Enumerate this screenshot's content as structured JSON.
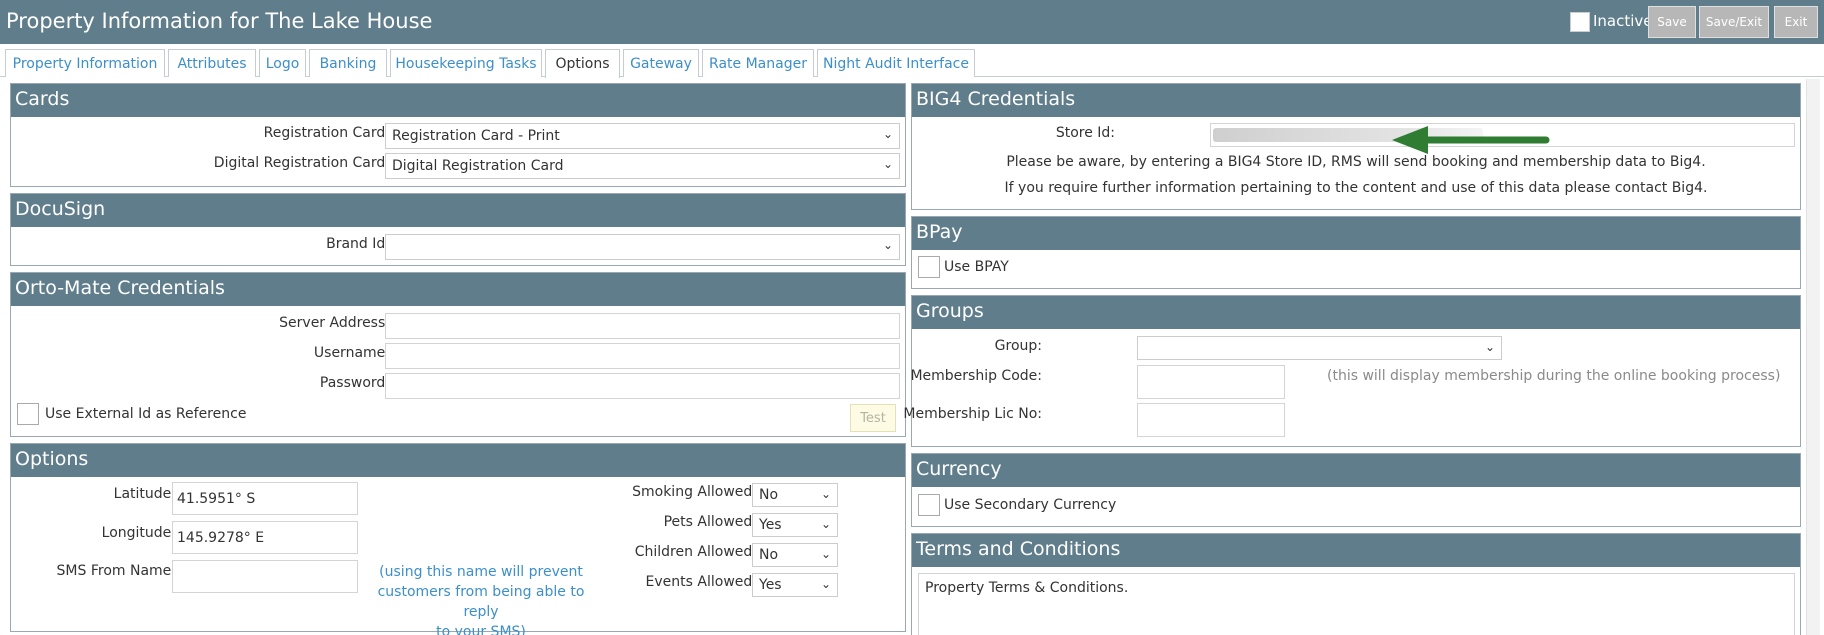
{
  "window": {
    "title": "Property Information for The Lake House",
    "inactive_label": "Inactive",
    "buttons": {
      "save": "Save",
      "save_exit": "Save/Exit",
      "exit": "Exit"
    }
  },
  "tabs": [
    {
      "label": "Property Information"
    },
    {
      "label": "Attributes"
    },
    {
      "label": "Logo"
    },
    {
      "label": "Banking"
    },
    {
      "label": "Housekeeping Tasks"
    },
    {
      "label": "Options"
    },
    {
      "label": "Gateway"
    },
    {
      "label": "Rate Manager"
    },
    {
      "label": "Night Audit Interface"
    }
  ],
  "cards": {
    "title": "Cards",
    "registration_card_label": "Registration Card:",
    "registration_card_value": "Registration Card - Print",
    "digital_registration_card_label": "Digital Registration Card:",
    "digital_registration_card_value": "Digital Registration Card"
  },
  "docusign": {
    "title": "DocuSign",
    "brand_id_label": "Brand Id:",
    "brand_id_value": ""
  },
  "ortomate": {
    "title": "Orto-Mate Credentials",
    "server_address_label": "Server Address:",
    "username_label": "Username:",
    "password_label": "Password:",
    "external_id_label": "Use External Id as Reference",
    "test_button": "Test"
  },
  "options": {
    "title": "Options",
    "latitude_label": "Latitude:",
    "latitude_value": "41.5951° S",
    "longitude_label": "Longitude:",
    "longitude_value": "145.9278° E",
    "sms_from_label": "SMS From Name:",
    "sms_from_value": "",
    "sms_note_line1": "(using this name will prevent",
    "sms_note_line2": "customers from being able to reply",
    "sms_note_line3": "to your SMS)",
    "smoking_label": "Smoking Allowed:",
    "smoking_value": "No",
    "pets_label": "Pets Allowed:",
    "pets_value": "Yes",
    "children_label": "Children Allowed:",
    "children_value": "No",
    "events_label": "Events Allowed:",
    "events_value": "Yes"
  },
  "big4": {
    "title": "BIG4 Credentials",
    "store_id_label": "Store Id:",
    "notice_line1": "Please be aware, by entering a BIG4 Store ID, RMS will send booking and membership data to Big4.",
    "notice_line2": "If you require further information pertaining to the content and use of this data please contact Big4."
  },
  "bpay": {
    "title": "BPay",
    "use_bpay_label": "Use BPAY"
  },
  "groups": {
    "title": "Groups",
    "group_label": "Group:",
    "group_value": "",
    "membership_code_label": "Membership Code:",
    "membership_code_hint": "(this will display membership during the online booking process)",
    "membership_lic_label": "Membership Lic No:"
  },
  "currency": {
    "title": "Currency",
    "secondary_label": "Use Secondary Currency"
  },
  "terms": {
    "title": "Terms and Conditions",
    "text": "Property Terms & Conditions."
  },
  "colors": {
    "header": "#607d8b",
    "link": "#3c8fc9",
    "arrow": "#2e7d32"
  }
}
